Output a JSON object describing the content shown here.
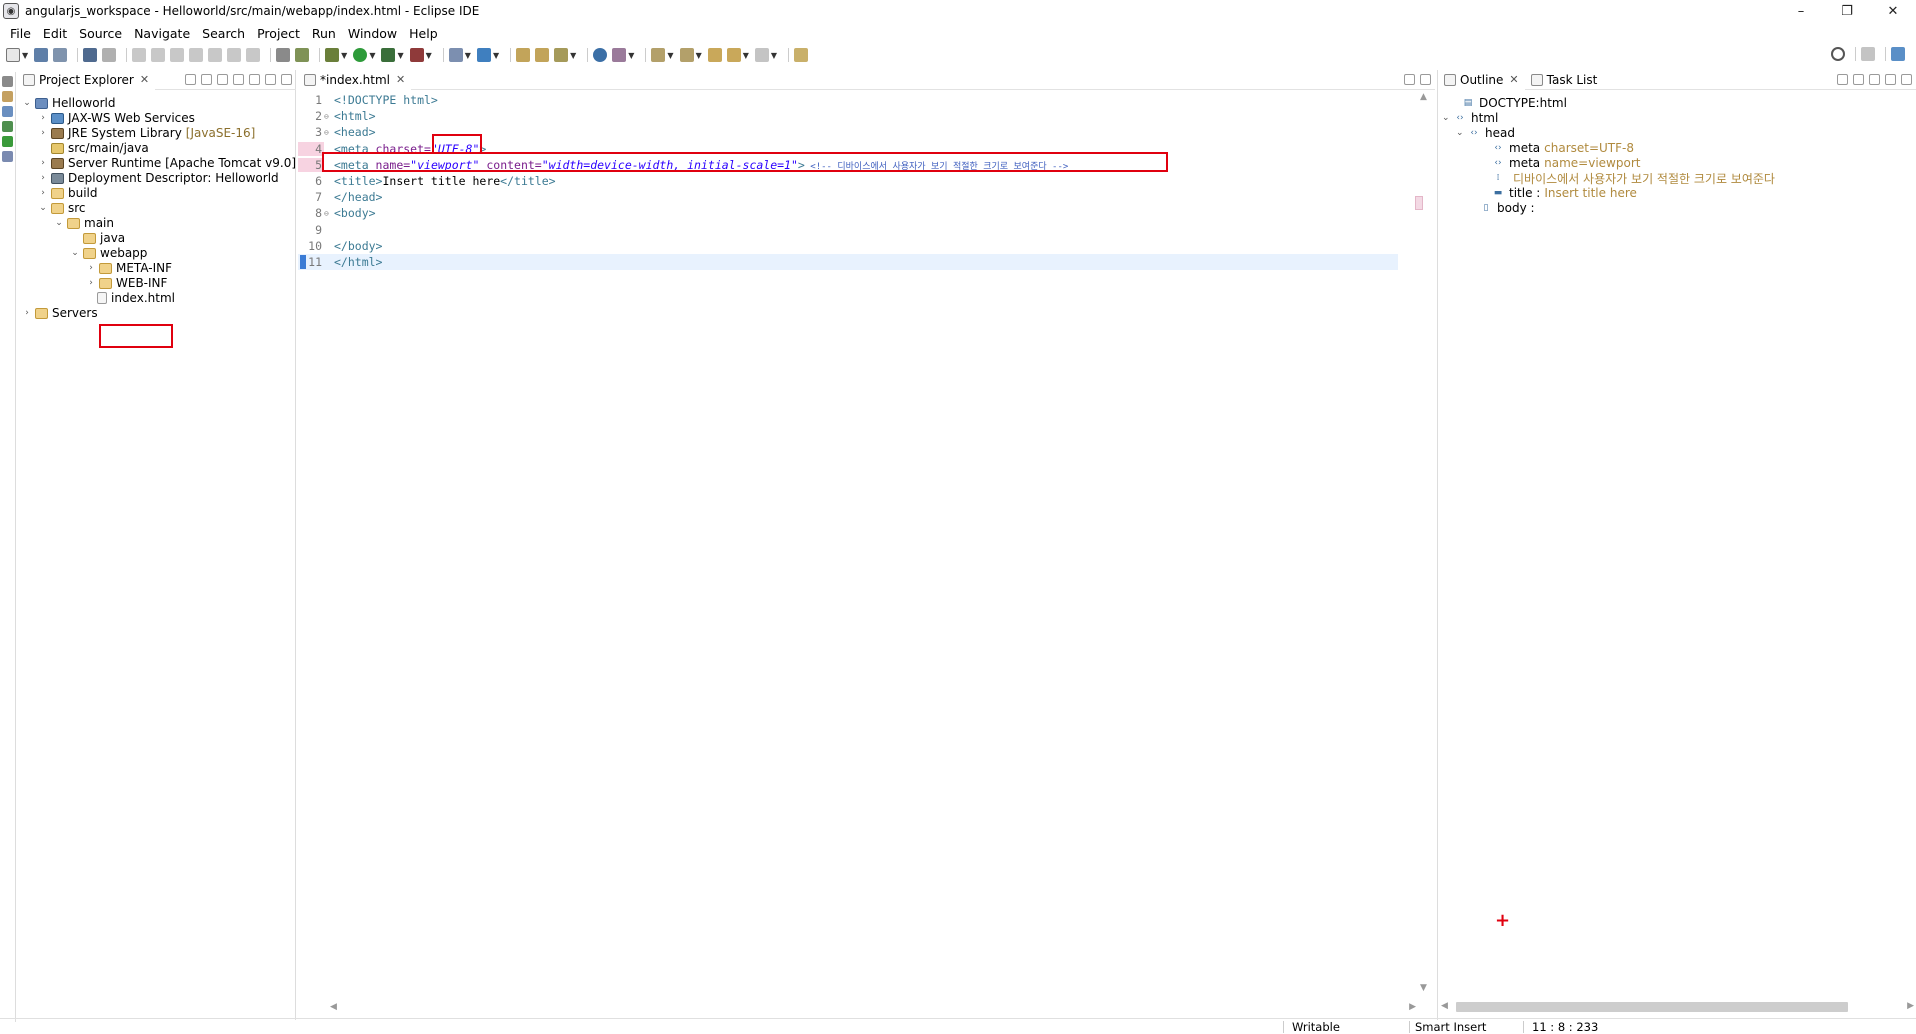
{
  "window": {
    "title": "angularjs_workspace - Helloworld/src/main/webapp/index.html - Eclipse IDE",
    "minimize": "–",
    "restore": "❐",
    "close": "✕"
  },
  "menu": [
    "File",
    "Edit",
    "Source",
    "Navigate",
    "Search",
    "Project",
    "Run",
    "Window",
    "Help"
  ],
  "project_explorer": {
    "tab_label": "Project Explorer",
    "tree": [
      {
        "label": "Helloworld",
        "twisty": "v",
        "icon": "project-icon",
        "suffix": ""
      },
      {
        "label": "JAX-WS Web Services",
        "twisty": ">",
        "icon": "web-services-icon",
        "suffix": ""
      },
      {
        "label": "JRE System Library",
        "twisty": ">",
        "icon": "library-icon",
        "suffix": "[JavaSE-16]"
      },
      {
        "label": "src/main/java",
        "twisty": "",
        "icon": "source-folder-icon",
        "suffix": ""
      },
      {
        "label": "Server Runtime [Apache Tomcat v9.0]",
        "twisty": ">",
        "icon": "library-icon",
        "suffix": ""
      },
      {
        "label": "Deployment Descriptor: Helloworld",
        "twisty": ">",
        "icon": "deployment-descriptor-icon",
        "suffix": ""
      },
      {
        "label": "build",
        "twisty": ">",
        "icon": "folder-icon",
        "suffix": ""
      },
      {
        "label": "src",
        "twisty": "v",
        "icon": "folder-icon",
        "suffix": ""
      },
      {
        "label": "main",
        "twisty": "v",
        "icon": "folder-icon",
        "suffix": ""
      },
      {
        "label": "java",
        "twisty": "",
        "icon": "folder-icon",
        "suffix": ""
      },
      {
        "label": "webapp",
        "twisty": "v",
        "icon": "folder-icon",
        "suffix": ""
      },
      {
        "label": "META-INF",
        "twisty": ">",
        "icon": "folder-icon",
        "suffix": ""
      },
      {
        "label": "WEB-INF",
        "twisty": ">",
        "icon": "folder-icon",
        "suffix": ""
      },
      {
        "label": "index.html",
        "twisty": "",
        "icon": "html-file-icon",
        "suffix": ""
      },
      {
        "label": "Servers",
        "twisty": ">",
        "icon": "folder-icon",
        "suffix": ""
      }
    ]
  },
  "editor": {
    "tab_label": "*index.html",
    "lines": [
      {
        "n": "1",
        "fold": "",
        "segments": [
          [
            "tag",
            "<!DOCTYPE html>"
          ]
        ]
      },
      {
        "n": "2",
        "fold": "⊖",
        "segments": [
          [
            "tag",
            "<html>"
          ]
        ]
      },
      {
        "n": "3",
        "fold": "⊖",
        "segments": [
          [
            "tag",
            "<head>"
          ]
        ]
      },
      {
        "n": "4",
        "fold": "",
        "segments": [
          [
            "tag",
            "<meta "
          ],
          [
            "attr",
            "charset="
          ],
          [
            "val",
            "\"UTF-8\""
          ],
          [
            "tag",
            ">"
          ]
        ]
      },
      {
        "n": "5",
        "fold": "",
        "segments": [
          [
            "tag",
            "<meta "
          ],
          [
            "attr",
            "name="
          ],
          [
            "val",
            "\"viewport\""
          ],
          [
            "attr",
            " content="
          ],
          [
            "val",
            "\"width=device-width, initial-scale=1\""
          ],
          [
            "tag",
            ">"
          ],
          [
            "cmt",
            " <!-- 디바이스에서 사용자가 보기 적절한 크기로 보여준다 -->"
          ]
        ]
      },
      {
        "n": "6",
        "fold": "",
        "segments": [
          [
            "tag",
            "<title>"
          ],
          [
            "plain",
            "Insert title here"
          ],
          [
            "tag",
            "</title>"
          ]
        ]
      },
      {
        "n": "7",
        "fold": "",
        "segments": [
          [
            "tag",
            "</head>"
          ]
        ]
      },
      {
        "n": "8",
        "fold": "⊖",
        "segments": [
          [
            "tag",
            "<body>"
          ]
        ]
      },
      {
        "n": "9",
        "fold": "",
        "segments": []
      },
      {
        "n": "10",
        "fold": "",
        "segments": [
          [
            "tag",
            "</body>"
          ]
        ]
      },
      {
        "n": "11",
        "fold": "",
        "segments": [
          [
            "tag",
            "</html>"
          ]
        ]
      }
    ]
  },
  "outline": {
    "tab_label": "Outline",
    "second_tab_label": "Task List",
    "tree": [
      {
        "label": "DOCTYPE:html",
        "detail": "",
        "twisty": "",
        "icon": "doctype-icon"
      },
      {
        "label": "html",
        "detail": "",
        "twisty": "v",
        "icon": "element-icon"
      },
      {
        "label": "head",
        "detail": "",
        "twisty": "v",
        "icon": "element-icon"
      },
      {
        "label": "meta",
        "detail": "charset=UTF-8",
        "twisty": "",
        "icon": "element-icon"
      },
      {
        "label": "meta",
        "detail": "name=viewport",
        "twisty": "",
        "icon": "element-icon"
      },
      {
        "label": "",
        "detail": "디바이스에서 사용자가 보기 적절한 크기로 보여준다",
        "twisty": "",
        "icon": "comment-icon"
      },
      {
        "label": "title :",
        "detail": "Insert title here",
        "twisty": "",
        "icon": "title-icon"
      },
      {
        "label": "body :",
        "detail": "",
        "twisty": "",
        "icon": "body-icon"
      }
    ]
  },
  "status": {
    "writable": "Writable",
    "insert_mode": "Smart Insert",
    "position": "11 : 8 : 233"
  },
  "colors": {
    "highlight": "#e0000f",
    "tag": "#3c7a93",
    "attribute": "#7a1e8c",
    "value": "#2a00ff",
    "comment": "#3f5fbf"
  }
}
